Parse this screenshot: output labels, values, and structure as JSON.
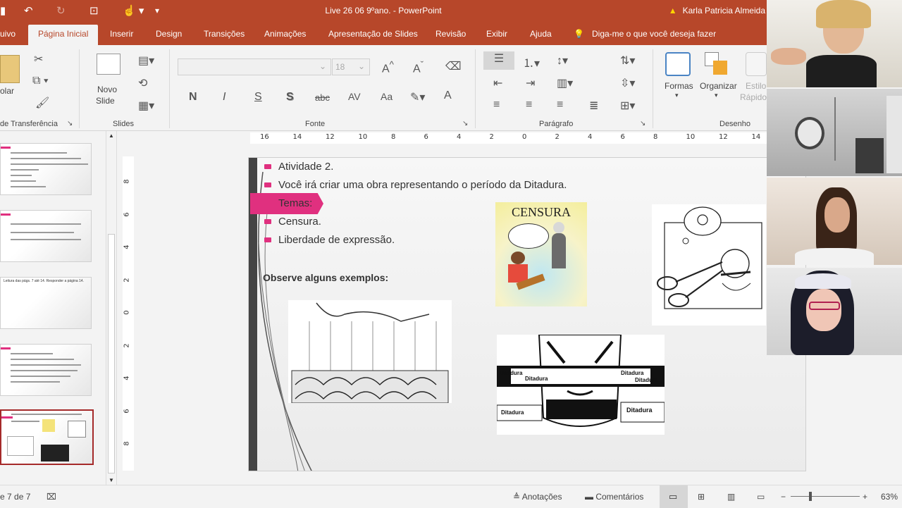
{
  "titlebar": {
    "doc_title": "Live 26 06  9ºano.  -  PowerPoint",
    "user_name": "Karla Patricia Almeida",
    "warning_icon": "warning-icon"
  },
  "tabs": [
    "uivo",
    "Página Inicial",
    "Inserir",
    "Design",
    "Transições",
    "Animações",
    "Apresentação de Slides",
    "Revisão",
    "Exibir",
    "Ajuda"
  ],
  "tell_me": "Diga-me o que você deseja fazer",
  "ribbon": {
    "clipboard": {
      "paste_label": "olar",
      "group_label": "de Transferência"
    },
    "slides": {
      "new_slide_label_1": "Novo",
      "new_slide_label_2": "Slide",
      "group_label": "Slides"
    },
    "font": {
      "size_value": "18",
      "group_label": "Fonte",
      "bold": "N",
      "italic": "I",
      "underline": "S",
      "shadow": "S",
      "strike": "abc",
      "spacing": "AV",
      "case": "Aa",
      "font_color": "A"
    },
    "paragraph": {
      "group_label": "Parágrafo"
    },
    "drawing": {
      "shapes_label": "Formas",
      "arrange_label": "Organizar",
      "styles_label_1": "Estilo",
      "styles_label_2": "Rápido",
      "group_label": "Desenho"
    }
  },
  "ruler": {
    "h_ticks": [
      "16",
      "14",
      "12",
      "10",
      "8",
      "6",
      "4",
      "2",
      "0",
      "2",
      "4",
      "6",
      "8",
      "10",
      "12",
      "14"
    ],
    "v_ticks": [
      "8",
      "6",
      "4",
      "2",
      "0",
      "2",
      "4",
      "6",
      "8"
    ]
  },
  "slide": {
    "bullets": [
      "Atividade 2.",
      "Você irá criar uma obra representando o período da Ditadura.",
      "Temas:",
      "Censura.",
      "Liberdade de expressão."
    ],
    "examples_label": "Observe alguns exemplos:",
    "censura_title": "CENSURA",
    "ditadura_word": "Ditadura"
  },
  "thumbnails": {
    "thumb3_title": "Leitura das págs. 7 até 14. Responder a página 14."
  },
  "statusbar": {
    "slide_counter": "e 7 de 7",
    "notes_label": "Anotações",
    "comments_label": "Comentários",
    "zoom": "63%"
  }
}
